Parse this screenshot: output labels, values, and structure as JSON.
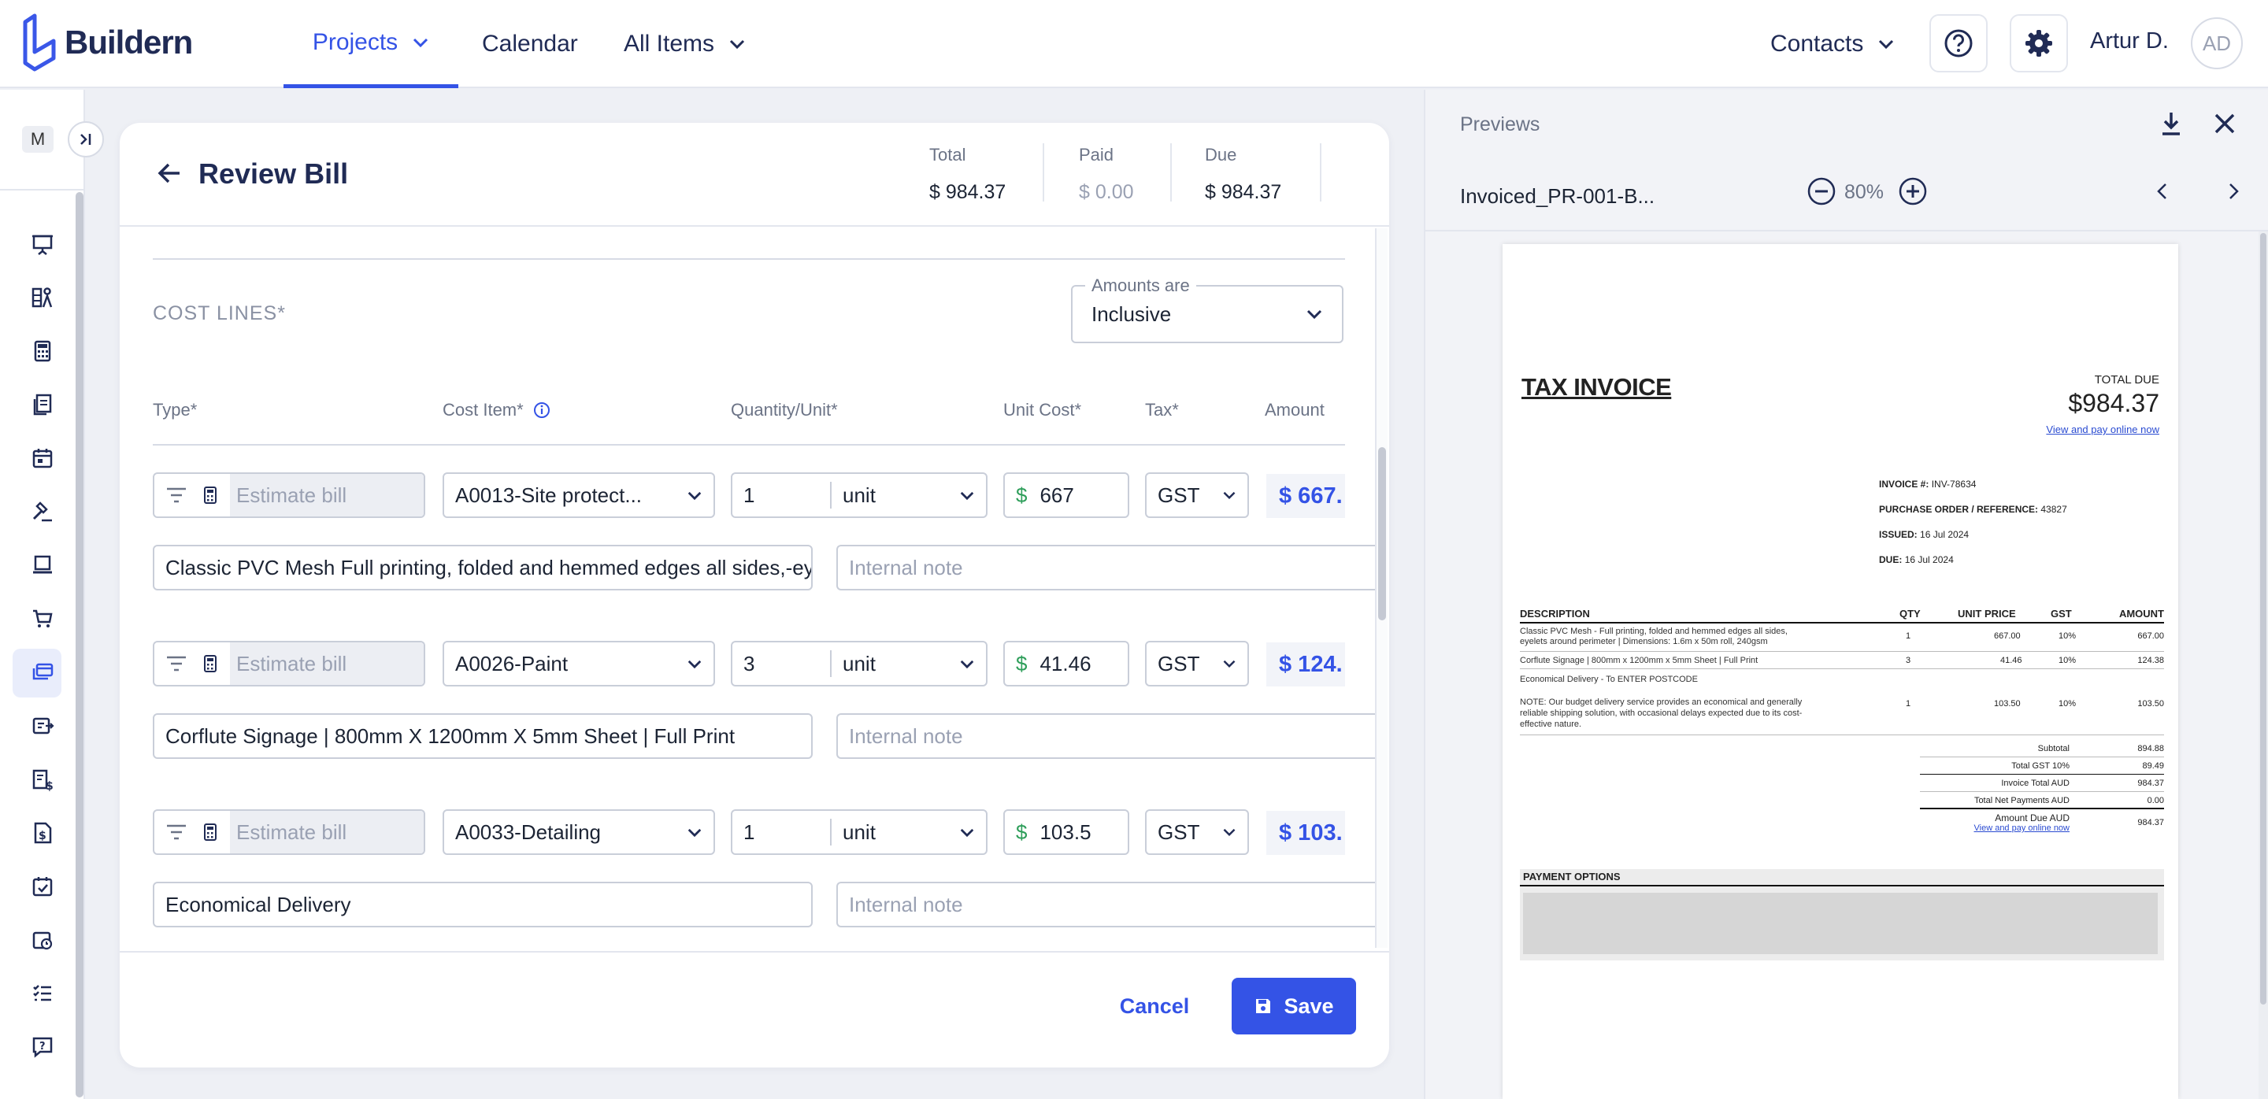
{
  "app": {
    "name": "Buildern"
  },
  "nav": {
    "projects": "Projects",
    "calendar": "Calendar",
    "all_items": "All Items",
    "contacts": "Contacts",
    "user_name": "Artur D.",
    "user_initials": "AD"
  },
  "sidebar": {
    "workspace_initial": "M"
  },
  "bill": {
    "title": "Review Bill",
    "total_label": "Total",
    "total_value": "$ 984.37",
    "paid_label": "Paid",
    "paid_value": "$ 0.00",
    "due_label": "Due",
    "due_value": "$ 984.37",
    "cost_lines_label": "COST LINES*",
    "amounts_are_label": "Amounts are",
    "amounts_are_value": "Inclusive",
    "columns": {
      "type": "Type*",
      "cost_item": "Cost Item*",
      "quantity": "Quantity/Unit*",
      "unit_cost": "Unit Cost*",
      "tax": "Tax*",
      "amount": "Amount"
    },
    "lines": [
      {
        "type_placeholder": "Estimate bill",
        "cost_item": "A0013-Site protect...",
        "qty": "1",
        "unit": "unit",
        "currency": "$",
        "unit_cost": "667",
        "tax": "GST",
        "amount": "$ 667.",
        "description": "Classic PVC Mesh Full printing, folded and hemmed edges all sides,-eye",
        "note_placeholder": "Internal note"
      },
      {
        "type_placeholder": "Estimate bill",
        "cost_item": "A0026-Paint",
        "qty": "3",
        "unit": "unit",
        "currency": "$",
        "unit_cost": "41.46",
        "tax": "GST",
        "amount": "$ 124.",
        "description": "Corflute Signage | 800mm X 1200mm X 5mm Sheet | Full Print",
        "note_placeholder": "Internal note"
      },
      {
        "type_placeholder": "Estimate bill",
        "cost_item": "A0033-Detailing",
        "qty": "1",
        "unit": "unit",
        "currency": "$",
        "unit_cost": "103.5",
        "tax": "GST",
        "amount": "$ 103.",
        "description": "Economical Delivery",
        "note_placeholder": "Internal note"
      }
    ],
    "cancel": "Cancel",
    "save": "Save"
  },
  "preview": {
    "title": "Previews",
    "filename": "Invoiced_PR-001-B...",
    "zoom": "80%",
    "invoice": {
      "heading": "TAX INVOICE",
      "total_due_label": "TOTAL DUE",
      "total_due": "$984.37",
      "pay_link": "View and pay online now",
      "invoice_no_label": "INVOICE #:",
      "invoice_no": "INV-78634",
      "po_label": "PURCHASE ORDER / REFERENCE:",
      "po": "43827",
      "issued_label": "ISSUED:",
      "issued": "16 Jul 2024",
      "due_label": "DUE:",
      "due": "16 Jul 2024",
      "headers": {
        "description": "DESCRIPTION",
        "qty": "QTY",
        "unit_price": "UNIT PRICE",
        "gst": "GST",
        "amount": "AMOUNT"
      },
      "rows": [
        {
          "desc1": "Classic PVC Mesh - Full printing, folded and hemmed edges all sides,",
          "desc2": "eyelets around perimeter | Dimensions: 1.6m x 50m roll, 240gsm",
          "qty": "1",
          "price": "667.00",
          "gst": "10%",
          "amount": "667.00"
        },
        {
          "desc1": "Corflute Signage | 800mm x 1200mm x 5mm Sheet | Full Print",
          "desc2": "",
          "qty": "3",
          "price": "41.46",
          "gst": "10%",
          "amount": "124.38"
        },
        {
          "desc1": "Economical Delivery - To ENTER POSTCODE",
          "desc2": "",
          "qty": "",
          "price": "",
          "gst": "",
          "amount": ""
        },
        {
          "desc1": "NOTE: Our budget delivery service provides an economical and generally",
          "desc2": "reliable shipping solution, with occasional delays expected due to its cost-",
          "desc3": "effective nature.",
          "qty": "1",
          "price": "103.50",
          "gst": "10%",
          "amount": "103.50"
        }
      ],
      "subtotal_label": "Subtotal",
      "subtotal": "894.88",
      "gst_label": "Total GST 10%",
      "gst": "89.49",
      "invoice_total_label": "Invoice Total AUD",
      "invoice_total": "984.37",
      "net_payments_label": "Total Net Payments AUD",
      "net_payments": "0.00",
      "amount_due_label": "Amount Due AUD",
      "amount_due": "984.37",
      "payment_options": "PAYMENT OPTIONS"
    }
  },
  "colors": {
    "accent": "#3453e6",
    "brand_dark": "#202b55",
    "currency_green": "#2e9e5a"
  }
}
